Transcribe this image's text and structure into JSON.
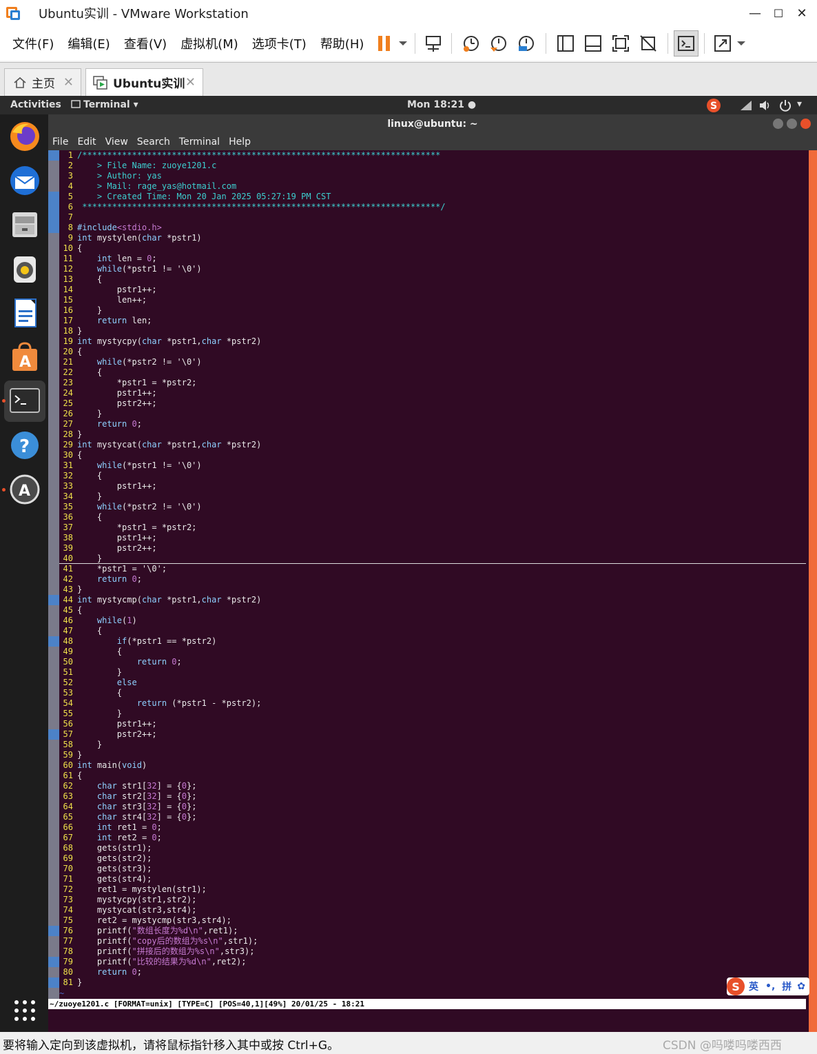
{
  "window": {
    "title": "Ubuntu实训 - VMware Workstation",
    "controls": {
      "minimize": "—",
      "maximize": "☐",
      "close": "✕"
    }
  },
  "menu": [
    "文件(F)",
    "编辑(E)",
    "查看(V)",
    "虚拟机(M)",
    "选项卡(T)",
    "帮助(H)"
  ],
  "tabs": [
    {
      "label": "主页",
      "close": "✕"
    },
    {
      "label": "Ubuntu实训",
      "close": "✕"
    }
  ],
  "gnome": {
    "activities": "Activities",
    "app": "Terminal ▾",
    "clock": "Mon 18:21 ●",
    "tray": "▾"
  },
  "terminal": {
    "title": "linux@ubuntu: ~",
    "menu": [
      "File",
      "Edit",
      "View",
      "Search",
      "Terminal",
      "Help"
    ]
  },
  "gutter_marks": [
    1,
    5,
    6,
    7,
    8,
    44,
    48,
    57,
    76,
    79,
    81
  ],
  "code_lines": [
    [
      {
        "t": "/************************************************************************",
        "c": "cm"
      }
    ],
    [
      {
        "t": "    > File Name: zuoye1201.c",
        "c": "cm"
      }
    ],
    [
      {
        "t": "    > Author: yas",
        "c": "cm"
      }
    ],
    [
      {
        "t": "    > Mail: rage_yas@hotmail.com",
        "c": "cm"
      }
    ],
    [
      {
        "t": "    > Created Time: Mon 20 Jan 2025 05:27:19 PM CST",
        "c": "cm"
      }
    ],
    [
      {
        "t": " ************************************************************************/",
        "c": "cm"
      }
    ],
    [
      {
        "t": "",
        "c": ""
      }
    ],
    [
      {
        "t": "#include",
        "c": "kw"
      },
      {
        "t": "<stdio.h>",
        "c": "lit"
      }
    ],
    [
      {
        "t": "int",
        "c": "kw"
      },
      {
        "t": " mystylen(",
        "c": ""
      },
      {
        "t": "char",
        "c": "kw"
      },
      {
        "t": " *pstr1)",
        "c": ""
      }
    ],
    [
      {
        "t": "{",
        "c": ""
      }
    ],
    [
      {
        "t": "    ",
        "c": ""
      },
      {
        "t": "int",
        "c": "kw"
      },
      {
        "t": " len = ",
        "c": ""
      },
      {
        "t": "0",
        "c": "lit"
      },
      {
        "t": ";",
        "c": ""
      }
    ],
    [
      {
        "t": "    ",
        "c": ""
      },
      {
        "t": "while",
        "c": "kw"
      },
      {
        "t": "(*pstr1 != '\\0')",
        "c": ""
      }
    ],
    [
      {
        "t": "    {",
        "c": ""
      }
    ],
    [
      {
        "t": "        pstr1++;",
        "c": ""
      }
    ],
    [
      {
        "t": "        len++;",
        "c": ""
      }
    ],
    [
      {
        "t": "    }",
        "c": ""
      }
    ],
    [
      {
        "t": "    ",
        "c": ""
      },
      {
        "t": "return",
        "c": "kw"
      },
      {
        "t": " len;",
        "c": ""
      }
    ],
    [
      {
        "t": "}",
        "c": ""
      }
    ],
    [
      {
        "t": "int",
        "c": "kw"
      },
      {
        "t": " mystycpy(",
        "c": ""
      },
      {
        "t": "char",
        "c": "kw"
      },
      {
        "t": " *pstr1,",
        "c": ""
      },
      {
        "t": "char",
        "c": "kw"
      },
      {
        "t": " *pstr2)",
        "c": ""
      }
    ],
    [
      {
        "t": "{",
        "c": ""
      }
    ],
    [
      {
        "t": "    ",
        "c": ""
      },
      {
        "t": "while",
        "c": "kw"
      },
      {
        "t": "(*pstr2 != '\\0')",
        "c": ""
      }
    ],
    [
      {
        "t": "    {",
        "c": ""
      }
    ],
    [
      {
        "t": "        *pstr1 = *pstr2;",
        "c": ""
      }
    ],
    [
      {
        "t": "        pstr1++;",
        "c": ""
      }
    ],
    [
      {
        "t": "        pstr2++;",
        "c": ""
      }
    ],
    [
      {
        "t": "    }",
        "c": ""
      }
    ],
    [
      {
        "t": "    ",
        "c": ""
      },
      {
        "t": "return",
        "c": "kw"
      },
      {
        "t": " ",
        "c": ""
      },
      {
        "t": "0",
        "c": "lit"
      },
      {
        "t": ";",
        "c": ""
      }
    ],
    [
      {
        "t": "}",
        "c": ""
      }
    ],
    [
      {
        "t": "int",
        "c": "kw"
      },
      {
        "t": " mystycat(",
        "c": ""
      },
      {
        "t": "char",
        "c": "kw"
      },
      {
        "t": " *pstr1,",
        "c": ""
      },
      {
        "t": "char",
        "c": "kw"
      },
      {
        "t": " *pstr2)",
        "c": ""
      }
    ],
    [
      {
        "t": "{",
        "c": ""
      }
    ],
    [
      {
        "t": "    ",
        "c": ""
      },
      {
        "t": "while",
        "c": "kw"
      },
      {
        "t": "(*pstr1 != '\\0')",
        "c": ""
      }
    ],
    [
      {
        "t": "    {",
        "c": ""
      }
    ],
    [
      {
        "t": "        pstr1++;",
        "c": ""
      }
    ],
    [
      {
        "t": "    }",
        "c": ""
      }
    ],
    [
      {
        "t": "    ",
        "c": ""
      },
      {
        "t": "while",
        "c": "kw"
      },
      {
        "t": "(*pstr2 != '\\0')",
        "c": ""
      }
    ],
    [
      {
        "t": "    {",
        "c": ""
      }
    ],
    [
      {
        "t": "        *pstr1 = *pstr2;",
        "c": ""
      }
    ],
    [
      {
        "t": "        pstr1++;",
        "c": ""
      }
    ],
    [
      {
        "t": "        pstr2++;",
        "c": ""
      }
    ],
    [
      {
        "t": "    }",
        "c": ""
      }
    ],
    [
      {
        "t": "    *pstr1 = '\\0';",
        "c": ""
      }
    ],
    [
      {
        "t": "    ",
        "c": ""
      },
      {
        "t": "return",
        "c": "kw"
      },
      {
        "t": " ",
        "c": ""
      },
      {
        "t": "0",
        "c": "lit"
      },
      {
        "t": ";",
        "c": ""
      }
    ],
    [
      {
        "t": "}",
        "c": ""
      }
    ],
    [
      {
        "t": "int",
        "c": "kw"
      },
      {
        "t": " mystycmp(",
        "c": ""
      },
      {
        "t": "char",
        "c": "kw"
      },
      {
        "t": " *pstr1,",
        "c": ""
      },
      {
        "t": "char",
        "c": "kw"
      },
      {
        "t": " *pstr2)",
        "c": ""
      }
    ],
    [
      {
        "t": "{",
        "c": ""
      }
    ],
    [
      {
        "t": "    ",
        "c": ""
      },
      {
        "t": "while",
        "c": "kw"
      },
      {
        "t": "(",
        "c": ""
      },
      {
        "t": "1",
        "c": "lit"
      },
      {
        "t": ")",
        "c": ""
      }
    ],
    [
      {
        "t": "    {",
        "c": ""
      }
    ],
    [
      {
        "t": "        ",
        "c": ""
      },
      {
        "t": "if",
        "c": "kw"
      },
      {
        "t": "(*pstr1 == *pstr2)",
        "c": ""
      }
    ],
    [
      {
        "t": "        {",
        "c": ""
      }
    ],
    [
      {
        "t": "            ",
        "c": ""
      },
      {
        "t": "return",
        "c": "kw"
      },
      {
        "t": " ",
        "c": ""
      },
      {
        "t": "0",
        "c": "lit"
      },
      {
        "t": ";",
        "c": ""
      }
    ],
    [
      {
        "t": "        }",
        "c": ""
      }
    ],
    [
      {
        "t": "        ",
        "c": ""
      },
      {
        "t": "else",
        "c": "kw"
      }
    ],
    [
      {
        "t": "        {",
        "c": ""
      }
    ],
    [
      {
        "t": "            ",
        "c": ""
      },
      {
        "t": "return",
        "c": "kw"
      },
      {
        "t": " (*pstr1 - *pstr2);",
        "c": ""
      }
    ],
    [
      {
        "t": "        }",
        "c": ""
      }
    ],
    [
      {
        "t": "        pstr1++;",
        "c": ""
      }
    ],
    [
      {
        "t": "        pstr2++;",
        "c": ""
      }
    ],
    [
      {
        "t": "    }",
        "c": ""
      }
    ],
    [
      {
        "t": "}",
        "c": ""
      }
    ],
    [
      {
        "t": "int",
        "c": "kw"
      },
      {
        "t": " main(",
        "c": ""
      },
      {
        "t": "void",
        "c": "kw"
      },
      {
        "t": ")",
        "c": ""
      }
    ],
    [
      {
        "t": "{",
        "c": ""
      }
    ],
    [
      {
        "t": "    ",
        "c": ""
      },
      {
        "t": "char",
        "c": "kw"
      },
      {
        "t": " str1[",
        "c": ""
      },
      {
        "t": "32",
        "c": "lit"
      },
      {
        "t": "] = {",
        "c": ""
      },
      {
        "t": "0",
        "c": "lit"
      },
      {
        "t": "};",
        "c": ""
      }
    ],
    [
      {
        "t": "    ",
        "c": ""
      },
      {
        "t": "char",
        "c": "kw"
      },
      {
        "t": " str2[",
        "c": ""
      },
      {
        "t": "32",
        "c": "lit"
      },
      {
        "t": "] = {",
        "c": ""
      },
      {
        "t": "0",
        "c": "lit"
      },
      {
        "t": "};",
        "c": ""
      }
    ],
    [
      {
        "t": "    ",
        "c": ""
      },
      {
        "t": "char",
        "c": "kw"
      },
      {
        "t": " str3[",
        "c": ""
      },
      {
        "t": "32",
        "c": "lit"
      },
      {
        "t": "] = {",
        "c": ""
      },
      {
        "t": "0",
        "c": "lit"
      },
      {
        "t": "};",
        "c": ""
      }
    ],
    [
      {
        "t": "    ",
        "c": ""
      },
      {
        "t": "char",
        "c": "kw"
      },
      {
        "t": " str4[",
        "c": ""
      },
      {
        "t": "32",
        "c": "lit"
      },
      {
        "t": "] = {",
        "c": ""
      },
      {
        "t": "0",
        "c": "lit"
      },
      {
        "t": "};",
        "c": ""
      }
    ],
    [
      {
        "t": "    ",
        "c": ""
      },
      {
        "t": "int",
        "c": "kw"
      },
      {
        "t": " ret1 = ",
        "c": ""
      },
      {
        "t": "0",
        "c": "lit"
      },
      {
        "t": ";",
        "c": ""
      }
    ],
    [
      {
        "t": "    ",
        "c": ""
      },
      {
        "t": "int",
        "c": "kw"
      },
      {
        "t": " ret2 = ",
        "c": ""
      },
      {
        "t": "0",
        "c": "lit"
      },
      {
        "t": ";",
        "c": ""
      }
    ],
    [
      {
        "t": "    gets(str1);",
        "c": ""
      }
    ],
    [
      {
        "t": "    gets(str2);",
        "c": ""
      }
    ],
    [
      {
        "t": "    gets(str3);",
        "c": ""
      }
    ],
    [
      {
        "t": "    gets(str4);",
        "c": ""
      }
    ],
    [
      {
        "t": "    ret1 = mystylen(str1);",
        "c": ""
      }
    ],
    [
      {
        "t": "    mystycpy(str1,str2);",
        "c": ""
      }
    ],
    [
      {
        "t": "    mystycat(str3,str4);",
        "c": ""
      }
    ],
    [
      {
        "t": "    ret2 = mystycmp(str3,str4);",
        "c": ""
      }
    ],
    [
      {
        "t": "    printf(",
        "c": ""
      },
      {
        "t": "\"数组长度为%d\\n\"",
        "c": "str"
      },
      {
        "t": ",ret1);",
        "c": ""
      }
    ],
    [
      {
        "t": "    printf(",
        "c": ""
      },
      {
        "t": "\"copy后的数组为%s\\n\"",
        "c": "str"
      },
      {
        "t": ",str1);",
        "c": ""
      }
    ],
    [
      {
        "t": "    printf(",
        "c": ""
      },
      {
        "t": "\"拼接后的数组为%s\\n\"",
        "c": "str"
      },
      {
        "t": ",str3);",
        "c": ""
      }
    ],
    [
      {
        "t": "    printf(",
        "c": ""
      },
      {
        "t": "\"比较的结果为%d\\n\"",
        "c": "str"
      },
      {
        "t": ",ret2);",
        "c": ""
      }
    ],
    [
      {
        "t": "    ",
        "c": ""
      },
      {
        "t": "return",
        "c": "kw"
      },
      {
        "t": " ",
        "c": ""
      },
      {
        "t": "0",
        "c": "lit"
      },
      {
        "t": ";",
        "c": ""
      }
    ],
    [
      {
        "t": "}",
        "c": ""
      }
    ]
  ],
  "tilde": "~",
  "statusline": "~/zuoye1201.c [FORMAT=unix] [TYPE=C] [POS=40,1][49%] 20/01/25 - 18:21",
  "ime": {
    "brand": "S",
    "lang": "英",
    "punct": "•,",
    "mode": "拼",
    "settings": "✿"
  },
  "bottom": {
    "message": "要将输入定向到该虚拟机，请将鼠标指针移入其中或按 Ctrl+G。",
    "watermark": "CSDN @吗喽吗喽西西"
  },
  "colors": {
    "terminal_bg": "#300a24",
    "line_number": "#f0e04a",
    "keyword": "#8ed0ff",
    "literal": "#c67ad2",
    "comment": "#3ccfd0",
    "scrollbar": "#f06b3a",
    "gutter_mark": "#4c82c8"
  }
}
